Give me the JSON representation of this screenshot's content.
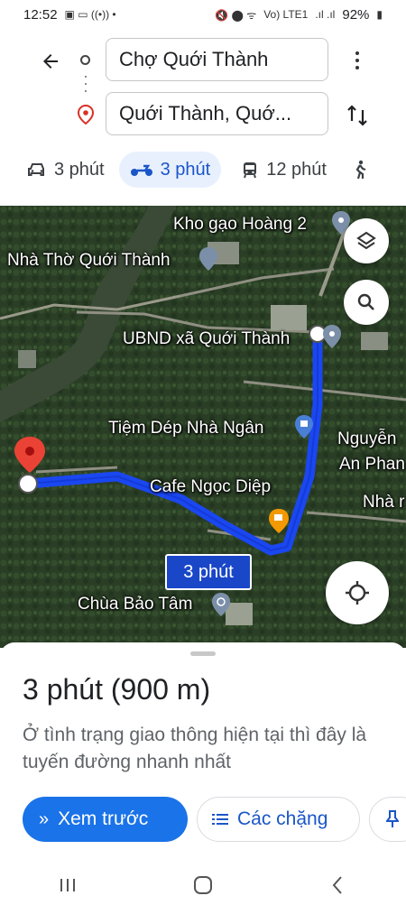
{
  "status_bar": {
    "time": "12:52",
    "battery": "92%",
    "signal_label": "Vo) LTE1"
  },
  "directions": {
    "origin": "Chợ Quới Thành",
    "destination": "Quới Thành, Quớ..."
  },
  "modes": [
    {
      "icon": "car-icon",
      "label": "3 phút",
      "active": false
    },
    {
      "icon": "motorbike-icon",
      "label": "3 phút",
      "active": true
    },
    {
      "icon": "transit-icon",
      "label": "12 phút",
      "active": false
    },
    {
      "icon": "walk-icon",
      "label": "",
      "active": false
    }
  ],
  "map": {
    "labels": {
      "kho_gao": "Kho gạo Hoàng 2",
      "nha_tho": "Nhà Thờ Quới Thành",
      "ubnd": "UBND xã Quới Thành",
      "tiem_dep": "Tiệm Dép Nhà Ngân",
      "nguyen": "Nguyễn",
      "an_phan": "An Phan",
      "nha_r": "Nhà r",
      "cafe": "Cafe Ngọc Diệp",
      "chua": "Chùa Bảo Tâm"
    },
    "route_time": "3 phút",
    "route_color": "#1a47f0"
  },
  "sheet": {
    "summary": "3 phút (900 m)",
    "description": "Ở tình trạng giao thông hiện tại thì đây là tuyến đường nhanh nhất",
    "preview_button": "Xem trước",
    "steps_button": "Các chặng"
  },
  "colors": {
    "accent": "#1a73e8",
    "active_mode_bg": "#e8f0fe"
  }
}
